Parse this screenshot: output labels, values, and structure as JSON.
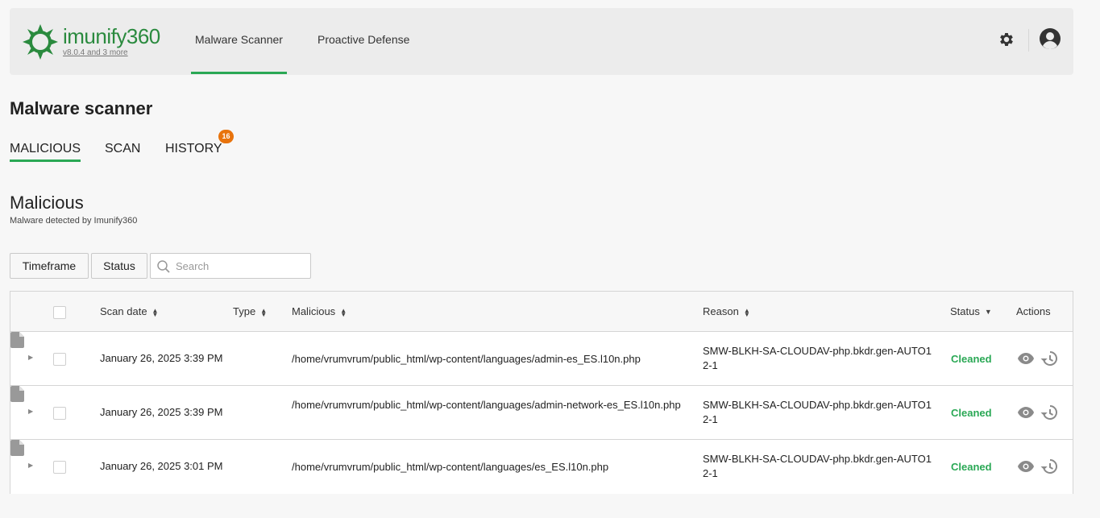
{
  "brand": {
    "name": "imunify360",
    "version": "v8.0.4 and 3 more",
    "color": "#2a8a3e"
  },
  "nav": {
    "items": [
      "Malware Scanner",
      "Proactive Defense"
    ],
    "active": 0
  },
  "icons": {
    "settings": "gear-icon",
    "user": "user-avatar-icon",
    "search": "search-icon",
    "file": "file-icon",
    "view": "eye-icon",
    "history": "history-icon"
  },
  "page": {
    "title": "Malware scanner"
  },
  "subtabs": {
    "items": [
      "MALICIOUS",
      "SCAN",
      "HISTORY"
    ],
    "history_badge": "16",
    "active": 0
  },
  "section": {
    "title": "Malicious",
    "subtitle": "Malware detected by Imunify360"
  },
  "filters": {
    "timeframe": "Timeframe",
    "status": "Status",
    "search_placeholder": "Search",
    "search_value": ""
  },
  "table": {
    "columns": {
      "scan_date": "Scan date",
      "type": "Type",
      "malicious": "Malicious",
      "reason": "Reason",
      "status": "Status",
      "actions": "Actions"
    },
    "rows": [
      {
        "date": "January 26, 2025 3:39 PM",
        "path": "/home/vrumvrum/public_html/wp-content/languages/admin-es_ES.l10n.php",
        "reason": "SMW-BLKH-SA-CLOUDAV-php.bkdr.gen-AUTO12-1",
        "status": "Cleaned"
      },
      {
        "date": "January 26, 2025 3:39 PM",
        "path": "/home/vrumvrum/public_html/wp-content/languages/admin-network-es_ES.l10n.php",
        "reason": "SMW-BLKH-SA-CLOUDAV-php.bkdr.gen-AUTO12-1",
        "status": "Cleaned"
      },
      {
        "date": "January 26, 2025 3:01 PM",
        "path": "/home/vrumvrum/public_html/wp-content/languages/es_ES.l10n.php",
        "reason": "SMW-BLKH-SA-CLOUDAV-php.bkdr.gen-AUTO12-1",
        "status": "Cleaned"
      }
    ]
  },
  "colors": {
    "accent": "#2aa855",
    "badge": "#e8730c",
    "status_cleaned": "#2aa855"
  }
}
